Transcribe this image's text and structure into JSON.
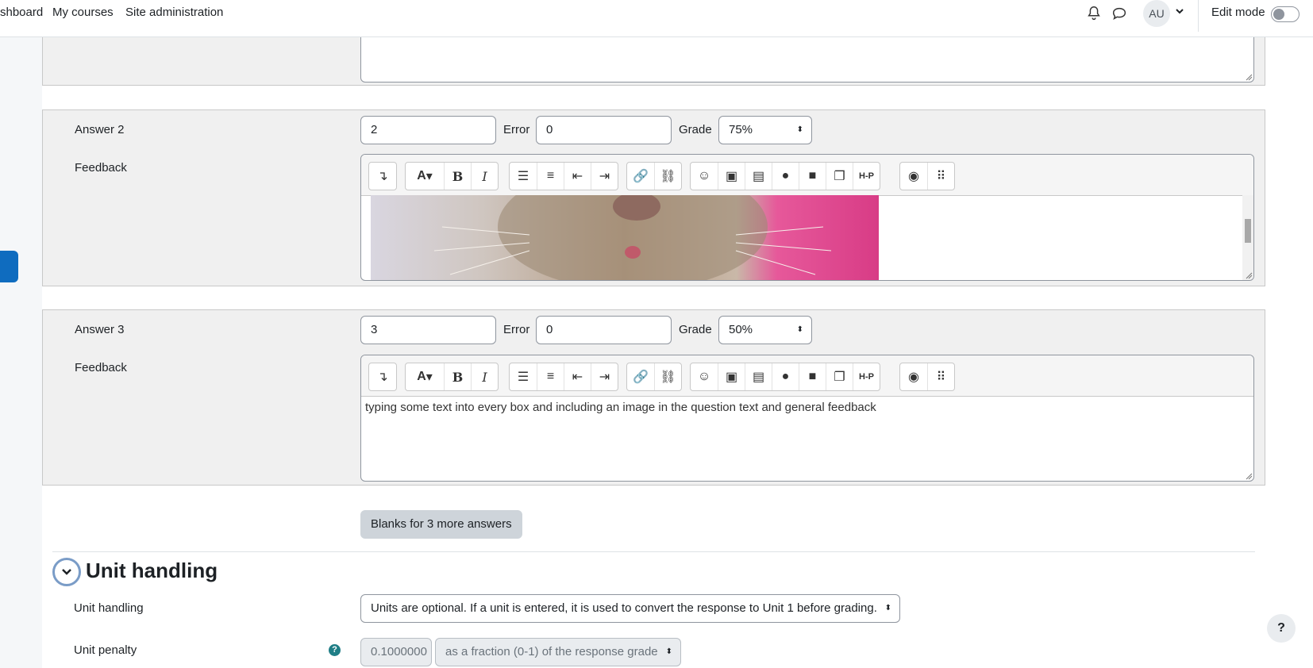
{
  "nav": {
    "links": [
      "shboard",
      "My courses",
      "Site administration"
    ],
    "avatar_initials": "AU",
    "edit_mode_label": "Edit mode",
    "edit_mode_on": false
  },
  "answers": [
    {
      "label": "Answer 2",
      "value": "2",
      "error_label": "Error",
      "error_value": "0",
      "grade_label": "Grade",
      "grade_value": "75%",
      "feedback_label": "Feedback",
      "feedback_text": ""
    },
    {
      "label": "Answer 3",
      "value": "3",
      "error_label": "Error",
      "error_value": "0",
      "grade_label": "Grade",
      "grade_value": "50%",
      "feedback_label": "Feedback",
      "feedback_text": "typing some text into every box and including an image in the question text and general feedback"
    }
  ],
  "blanks_button": "Blanks for 3 more answers",
  "unit_section": {
    "title": "Unit handling",
    "unit_handling_label": "Unit handling",
    "unit_handling_value": "Units are optional. If a unit is entered, it is used to convert the response to Unit 1 before grading.",
    "unit_penalty_label": "Unit penalty",
    "unit_penalty_value": "0.1000000",
    "unit_penalty_mode": "as a fraction (0-1) of the response grade"
  },
  "help_fab": "?",
  "colors": {
    "accent": "#0f6cbf",
    "fieldset_bg": "#f0f0f0",
    "help": "#1f7e86"
  }
}
